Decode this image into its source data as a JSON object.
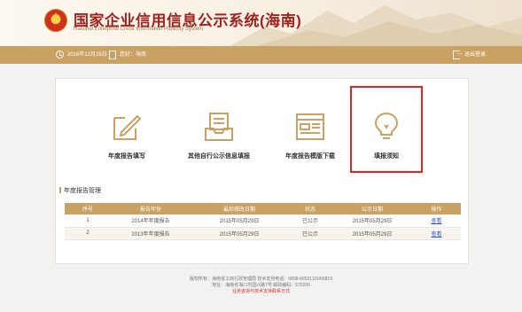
{
  "header": {
    "title": "国家企业信用信息公示系统(海南)",
    "subtitle": "National Enterprise Credit Information Publicity System"
  },
  "topbar": {
    "date": "2016年12月25日",
    "user_label": "您好：海南",
    "logout": "退出登录"
  },
  "functions": [
    {
      "label": "年度报告填写",
      "icon": "edit-document-icon"
    },
    {
      "label": "其他自行公示信息填报",
      "icon": "inbox-tray-icon"
    },
    {
      "label": "年度报告模版下载",
      "icon": "template-window-icon"
    },
    {
      "label": "填报须知",
      "icon": "lightbulb-icon"
    }
  ],
  "section": {
    "title": "年度报告管理"
  },
  "table": {
    "headers": [
      "序号",
      "报告年份",
      "最后修改日期",
      "状态",
      "公示日期",
      "操作"
    ],
    "rows": [
      [
        "1",
        "2014年年度报告",
        "2015年05月29日",
        "已公示",
        "2015年05月29日",
        "查看"
      ],
      [
        "2",
        "2013年年度报告",
        "2015年05月29日",
        "已公示",
        "2015年05月29日",
        "查看"
      ]
    ]
  },
  "footer": {
    "line1": "版权所有：海南省工商行政管理局 技术支持电话：0898-66521115/66819",
    "line2": "地址：海南省海口市国兴路7号 邮政编码：570206",
    "line3": "业务咨询与技术支持联系方式"
  },
  "colors": {
    "accent": "#c9a163",
    "title_red": "#a0231f",
    "link_blue": "#2a56c6",
    "highlight_red": "#e02525"
  }
}
